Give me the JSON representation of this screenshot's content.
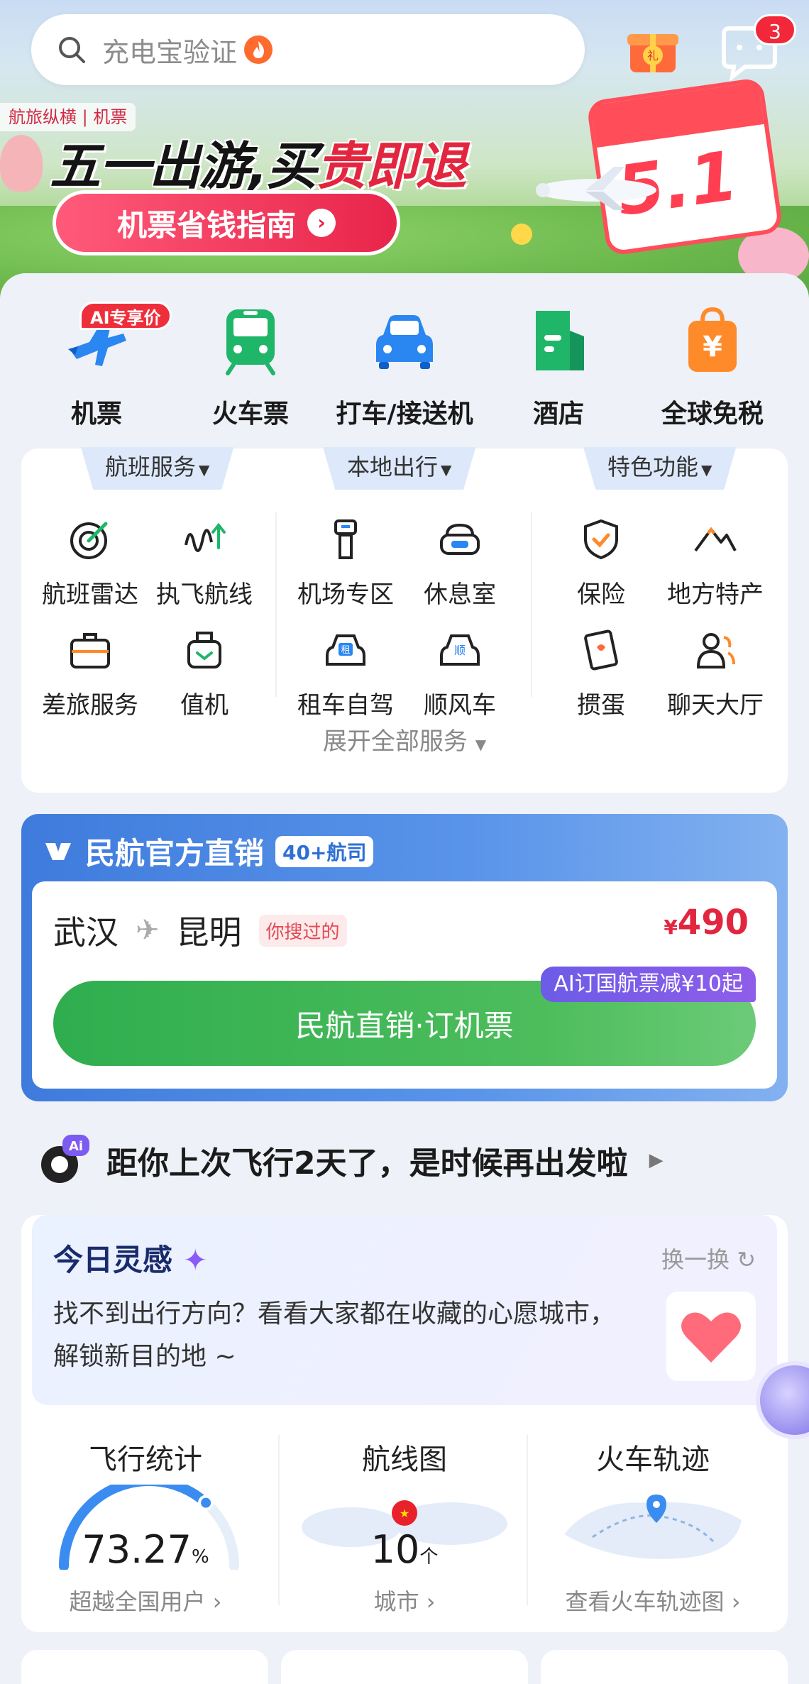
{
  "search": {
    "placeholder": "充电宝验证"
  },
  "header": {
    "message_count": "3"
  },
  "banner": {
    "tag": "航旅纵横 | 机票",
    "slogan_prefix": "五一出游,买",
    "slogan_red": "贵即退",
    "cta": "机票省钱指南",
    "calendar": "5.1"
  },
  "categories": [
    {
      "label": "机票",
      "badge": "AI专享价"
    },
    {
      "label": "火车票"
    },
    {
      "label": "打车/接送机"
    },
    {
      "label": "酒店"
    },
    {
      "label": "全球免税"
    }
  ],
  "services": {
    "groups": [
      "航班服务",
      "本地出行",
      "特色功能"
    ],
    "items": [
      "航班雷达",
      "执飞航线",
      "机场专区",
      "休息室",
      "保险",
      "地方特产",
      "差旅服务",
      "值机",
      "租车自驾",
      "顺风车",
      "掼蛋",
      "聊天大厅"
    ],
    "expand": "展开全部服务"
  },
  "caac": {
    "title": "民航官方直销",
    "pill": "40+航司",
    "from": "武汉",
    "to": "昆明",
    "recent": "你搜过的",
    "currency": "¥",
    "price": "490",
    "book": "民航直销·订机票",
    "promo": "AI订国航票减¥10起"
  },
  "reminder": {
    "text": "距你上次飞行2天了，是时候再出发啦"
  },
  "inspiration": {
    "title": "今日灵感",
    "refresh": "换一换",
    "body": "找不到出行方向？看看大家都在收藏的心愿城市，解锁新目的地 ~"
  },
  "stats": {
    "flight": {
      "title": "飞行统计",
      "value": "73.27",
      "unit": "%",
      "sub": "超越全国用户"
    },
    "route": {
      "title": "航线图",
      "value": "10",
      "unit": "个",
      "sub": "城市"
    },
    "train": {
      "title": "火车轨迹",
      "sub": "查看火车轨迹图"
    }
  },
  "colors": {
    "accent_red": "#e2263f",
    "caac_blue": "#3f7bdc",
    "book_green": "#2fae4f",
    "promo_purple": "#6c5ce7"
  }
}
